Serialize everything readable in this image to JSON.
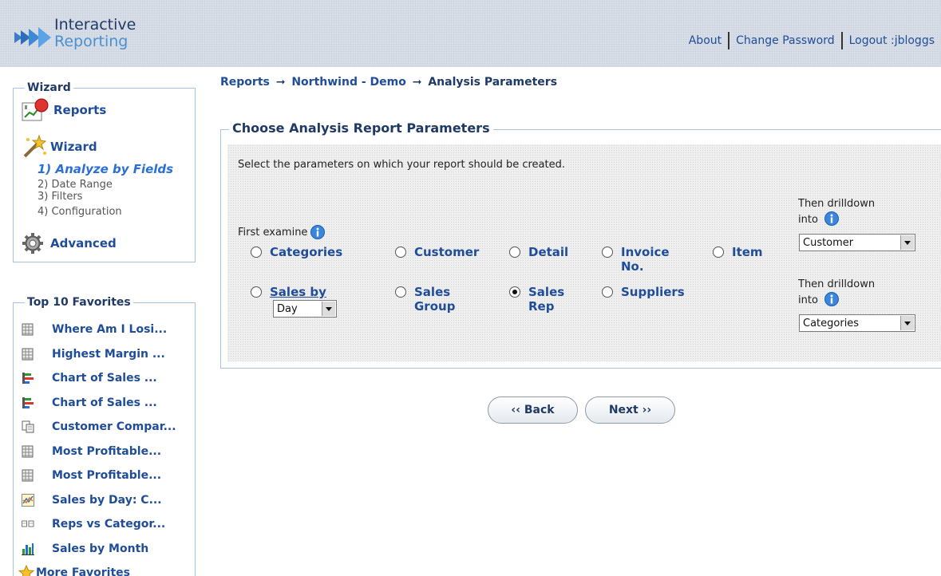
{
  "header": {
    "logo_line1": "Interactive",
    "logo_line2": "Reporting",
    "links": [
      "About",
      "Change Password",
      "Logout :jbloggs"
    ]
  },
  "wizard_panel": {
    "legend": "Wizard",
    "reports_label": "Reports",
    "wizard_label": "Wizard",
    "steps": [
      "1) Analyze by Fields",
      "2) Date Range",
      "3) Filters",
      "4) Configuration"
    ],
    "advanced_label": "Advanced"
  },
  "favorites": {
    "legend": "Top 10 Favorites",
    "items": [
      {
        "label": "Where Am I Losi...",
        "icon": "grid-report-icon"
      },
      {
        "label": "Highest Margin ...",
        "icon": "grid-report-icon"
      },
      {
        "label": "Chart of Sales ...",
        "icon": "bar-chart-icon"
      },
      {
        "label": "Chart of Sales ...",
        "icon": "bar-chart-icon"
      },
      {
        "label": "Customer Compar...",
        "icon": "document-compare-icon"
      },
      {
        "label": "Most Profitable...",
        "icon": "grid-report-icon"
      },
      {
        "label": "Most Profitable...",
        "icon": "grid-report-icon"
      },
      {
        "label": "Sales by Day: C...",
        "icon": "line-chart-icon"
      },
      {
        "label": "Reps vs Categor...",
        "icon": "pivot-icon"
      },
      {
        "label": "Sales by Month",
        "icon": "column-chart-icon"
      }
    ],
    "more_label": "More Favorites"
  },
  "breadcrumb": {
    "items": [
      "Reports",
      "Northwind - Demo",
      "Analysis Parameters"
    ],
    "arrow": "➞"
  },
  "params": {
    "legend": "Choose Analysis Report Parameters",
    "intro": "Select the parameters on which your report should be created.",
    "first_examine": "First examine",
    "options": [
      {
        "label": "Categories",
        "checked": false
      },
      {
        "label": "Customer",
        "checked": false
      },
      {
        "label": "Detail",
        "checked": false
      },
      {
        "label": "Invoice No.",
        "checked": false
      },
      {
        "label": "Item",
        "checked": false
      },
      {
        "label": "Sales by",
        "checked": false
      },
      {
        "label": "Sales Group",
        "checked": false
      },
      {
        "label": "Sales Rep",
        "checked": true
      },
      {
        "label": "Suppliers",
        "checked": false
      }
    ],
    "sales_by_select": "Day",
    "drilldown_label": "Then drilldown into",
    "drilldown1_value": "Customer",
    "drilldown2_value": "Categories"
  },
  "buttons": {
    "back": "‹‹ Back",
    "next": "Next ››"
  }
}
